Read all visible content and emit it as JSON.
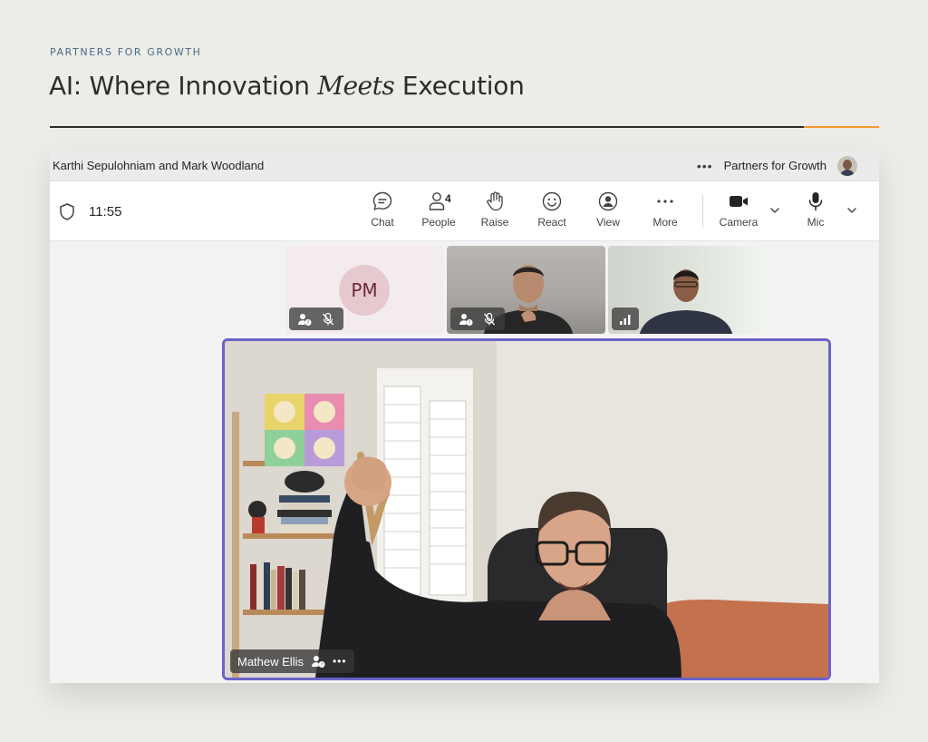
{
  "header": {
    "eyebrow": "PARTNERS FOR GROWTH",
    "title_before": "AI: Where Innovation ",
    "title_em": "Meets",
    "title_after": " Execution",
    "accent_color": "#f29a2e"
  },
  "window": {
    "title": "Karthi Sepulohniam and Mark Woodland",
    "org_name": "Partners for Growth"
  },
  "toolbar": {
    "time": "11:55",
    "chat_label": "Chat",
    "people_label": "People",
    "people_count": "4",
    "raise_label": "Raise",
    "react_label": "React",
    "view_label": "View",
    "more_label": "More",
    "camera_label": "Camera",
    "mic_label": "Mic"
  },
  "participants": {
    "pm_initials": "PM",
    "main_name": "Mathew Ellis"
  },
  "colors": {
    "speaker_border": "#6b63c9",
    "pm_avatar_bg": "#e6c9cf"
  }
}
